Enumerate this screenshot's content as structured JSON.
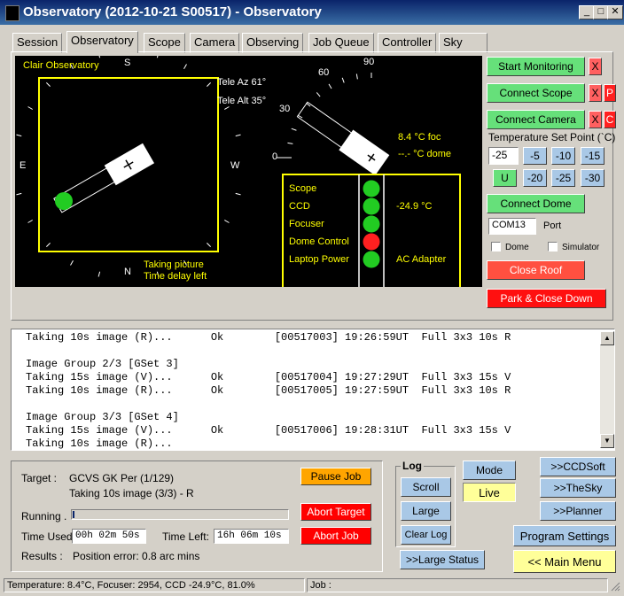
{
  "window": {
    "title": "Observatory (2012-10-21 S00517) - Observatory",
    "minimize_glyph": "_",
    "maximize_glyph": "□",
    "close_glyph": "✕"
  },
  "tabs": [
    {
      "label": "Session",
      "active": false
    },
    {
      "label": "Observatory",
      "active": true
    },
    {
      "label": "Scope",
      "active": false
    },
    {
      "label": "Camera",
      "active": false
    },
    {
      "label": "Observing",
      "active": false
    },
    {
      "label": "Job Queue",
      "active": false
    },
    {
      "label": "Controller",
      "active": false
    },
    {
      "label": "Sky",
      "active": false
    }
  ],
  "sky": {
    "observatory_name": "Clair Observatory",
    "north": "N",
    "south": "S",
    "east": "E",
    "west": "W",
    "tele_az": "Tele Az 61°",
    "tele_alt": "Tele Alt 35°",
    "taking_picture": "Taking picture",
    "time_delay": "Time delay left"
  },
  "altitude": {
    "ticks": [
      "0",
      "30",
      "60",
      "90"
    ],
    "foc_temp": "8.4 °C foc",
    "dome_temp": "--.- °C dome"
  },
  "status_panel": {
    "rows": [
      {
        "label": "Scope",
        "color": "#22cc22",
        "value": ""
      },
      {
        "label": "CCD",
        "color": "#22cc22",
        "value": "-24.9 °C"
      },
      {
        "label": "Focuser",
        "color": "#22cc22",
        "value": ""
      },
      {
        "label": "Dome Control",
        "color": "#ff2020",
        "value": ""
      },
      {
        "label": "Laptop Power",
        "color": "#22cc22",
        "value": "AC Adapter"
      }
    ]
  },
  "controls": {
    "start_monitoring": "Start Monitoring",
    "connect_scope": "Connect Scope",
    "connect_camera": "Connect Camera",
    "x_label": "X",
    "p_label": "P",
    "c_label": "C",
    "temp_setpoint_label": "Temperature Set Point (`C)",
    "temp_value": "-25",
    "temp_buttons_row1": [
      "-5",
      "-10",
      "-15"
    ],
    "u_label": "U",
    "temp_buttons_row2": [
      "-20",
      "-25",
      "-30"
    ],
    "connect_dome": "Connect Dome",
    "port_value": "COM13",
    "port_label": "Port",
    "dome_checkbox": "Dome",
    "simulator_checkbox": "Simulator",
    "close_roof": "Close Roof",
    "park_close_down": "Park & Close Down"
  },
  "log_lines": [
    {
      "text": "Taking 10s image (R)...      Ok        [00517003] 19:26:59UT  Full 3x3 10s R"
    },
    {
      "text": ""
    },
    {
      "text": "Image Group 2/3 [GSet 3]"
    },
    {
      "text": "Taking 15s image (V)...      Ok        [00517004] 19:27:29UT  Full 3x3 15s V"
    },
    {
      "text": "Taking 10s image (R)...      Ok        [00517005] 19:27:59UT  Full 3x3 10s R"
    },
    {
      "text": ""
    },
    {
      "text": "Image Group 3/3 [GSet 4]"
    },
    {
      "text": "Taking 15s image (V)...      Ok        [00517006] 19:28:31UT  Full 3x3 15s V"
    },
    {
      "text": "Taking 10s image (R)..."
    }
  ],
  "job": {
    "target_label": "Target :",
    "target_value": "GCVS GK Per (1/129)",
    "subtask": "Taking 10s image (3/3) - R",
    "running_label": "Running .",
    "progress_fraction": 0.01,
    "time_used_label": "Time Used:",
    "time_used": "00h 02m 50s",
    "time_left_label": "Time Left:",
    "time_left": "16h 06m 10s",
    "results_label": "Results :",
    "results_value": "Position error: 0.8 arc mins",
    "pause_job": "Pause Job",
    "abort_target": "Abort Target",
    "abort_job": "Abort Job"
  },
  "log_group": {
    "title": "Log",
    "scroll": "Scroll",
    "large": "Large",
    "clear_log": "Clear Log"
  },
  "mode": {
    "mode_label": "Mode",
    "live_label": "Live",
    "large_status": ">>Large Status"
  },
  "nav": {
    "ccdsoft": ">>CCDSoft",
    "thesky": ">>TheSky",
    "planner": ">>Planner",
    "program_settings": "Program Settings",
    "main_menu": "<< Main Menu"
  },
  "statusbar": {
    "left": "Temperature:  8.4°C, Focuser: 2954, CCD -24.9°C, 81.0%",
    "job": "Job :"
  },
  "colors": {
    "title_bar": "#0a246a",
    "panel_yellow": "#ffff00",
    "button_green": "#66e07a",
    "button_red": "#ff0000",
    "button_orange": "#ffa500",
    "button_blue": "#a9c8e6",
    "main_menu_yellow": "#ffff99"
  }
}
